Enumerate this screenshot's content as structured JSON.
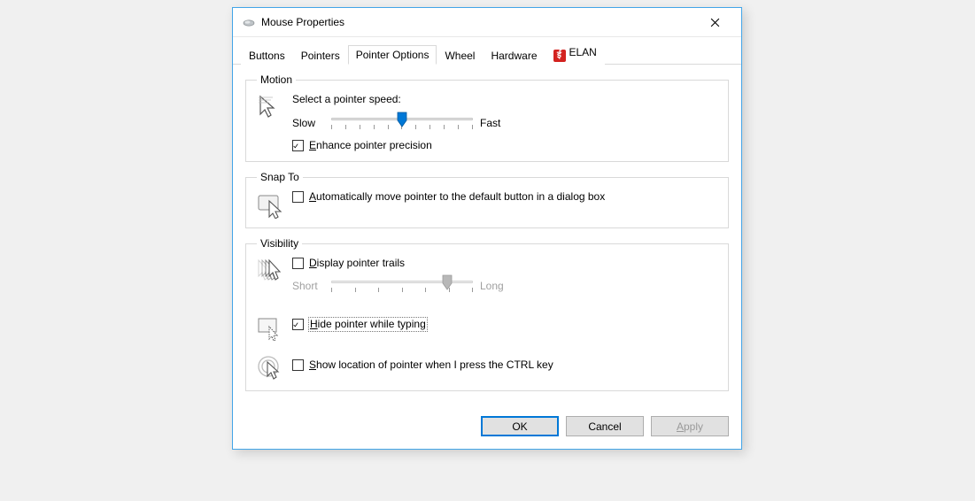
{
  "window": {
    "title": "Mouse Properties"
  },
  "tabs": [
    {
      "label": "Buttons"
    },
    {
      "label": "Pointers"
    },
    {
      "label": "Pointer Options"
    },
    {
      "label": "Wheel"
    },
    {
      "label": "Hardware"
    },
    {
      "label": "ELAN"
    }
  ],
  "motion": {
    "legend": "Motion",
    "prompt": "Select a pointer speed:",
    "slow": "Slow",
    "fast": "Fast",
    "speed_position_pct": 50,
    "enhance_label_pre": "",
    "enhance_ul": "E",
    "enhance_label_post": "nhance pointer precision",
    "enhance_checked": true
  },
  "snap": {
    "legend": "Snap To",
    "ul": "A",
    "label_post": "utomatically move pointer to the default button in a dialog box",
    "checked": false
  },
  "visibility": {
    "legend": "Visibility",
    "trails_ul": "D",
    "trails_post": "isplay pointer trails",
    "trails_checked": false,
    "short": "Short",
    "long": "Long",
    "trails_position_pct": 82,
    "hide_ul": "H",
    "hide_post": "ide pointer while typing",
    "hide_checked": true,
    "show_ul": "S",
    "show_post": "how location of pointer when I press the CTRL key",
    "show_checked": false
  },
  "buttons": {
    "ok": "OK",
    "cancel": "Cancel",
    "apply_ul": "A",
    "apply_post": "pply"
  }
}
